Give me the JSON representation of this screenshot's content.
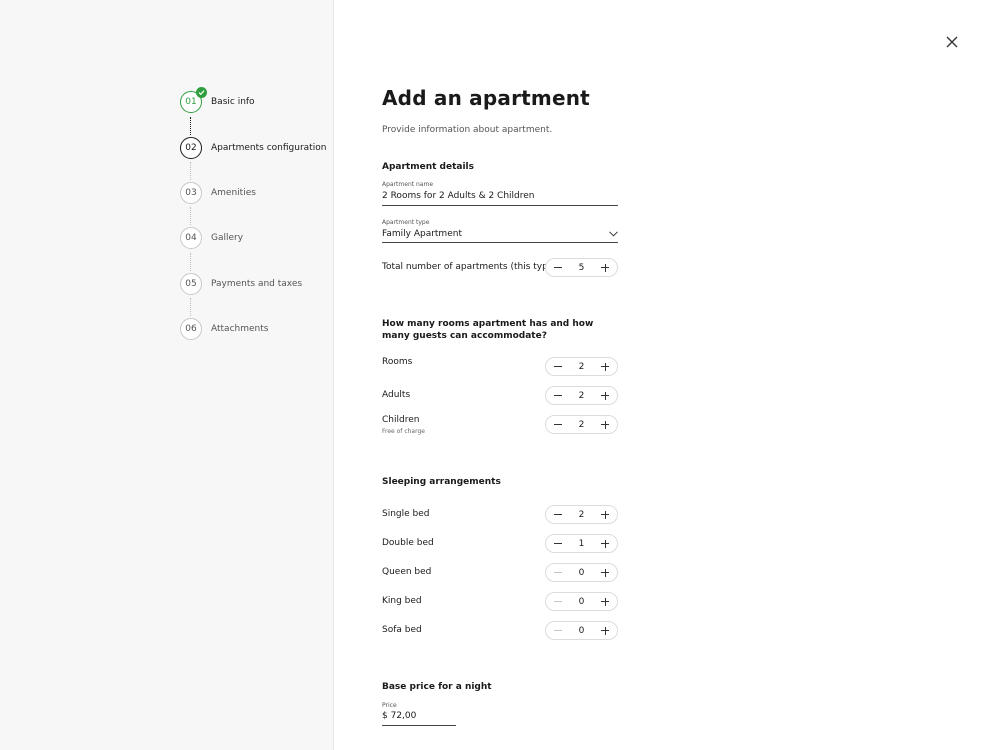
{
  "steps": [
    {
      "number": "01",
      "label": "Basic info",
      "status": "done"
    },
    {
      "number": "02",
      "label": "Apartments configuration",
      "status": "current"
    },
    {
      "number": "03",
      "label": "Amenities",
      "status": "upcoming"
    },
    {
      "number": "04",
      "label": "Gallery",
      "status": "upcoming"
    },
    {
      "number": "05",
      "label": "Payments and taxes",
      "status": "upcoming"
    },
    {
      "number": "06",
      "label": "Attachments",
      "status": "upcoming"
    }
  ],
  "page": {
    "title": "Add an apartment",
    "subtitle": "Provide information about apartment."
  },
  "details": {
    "section_title": "Apartment details",
    "name_label": "Apartment name",
    "name_value": "2 Rooms for 2 Adults & 2 Children",
    "type_label": "Apartment type",
    "type_value": "Family Apartment",
    "total_label": "Total number of apartments (this type)",
    "total_value": "5"
  },
  "occupancy": {
    "question": "How many rooms apartment has and how many guests can accommodate?",
    "rooms_label": "Rooms",
    "rooms_value": "2",
    "adults_label": "Adults",
    "adults_value": "2",
    "children_label": "Children",
    "children_note": "Free of charge",
    "children_value": "2"
  },
  "sleeping": {
    "section_title": "Sleeping arrangements",
    "single_label": "Single bed",
    "single_value": "2",
    "double_label": "Double bed",
    "double_value": "1",
    "queen_label": "Queen bed",
    "queen_value": "0",
    "king_label": "King bed",
    "king_value": "0",
    "sofa_label": "Sofa bed",
    "sofa_value": "0"
  },
  "price": {
    "section_title": "Base price for a night",
    "label": "Price",
    "value": "$ 72,00"
  },
  "colors": {
    "success": "#2e9e3e",
    "text": "#1a1a1a",
    "sidebar_bg": "#f7f7f7"
  },
  "icons": {
    "close": "close-icon",
    "check": "check-icon",
    "chevron": "chevron-down-icon",
    "minus": "minus-icon",
    "plus": "plus-icon"
  }
}
